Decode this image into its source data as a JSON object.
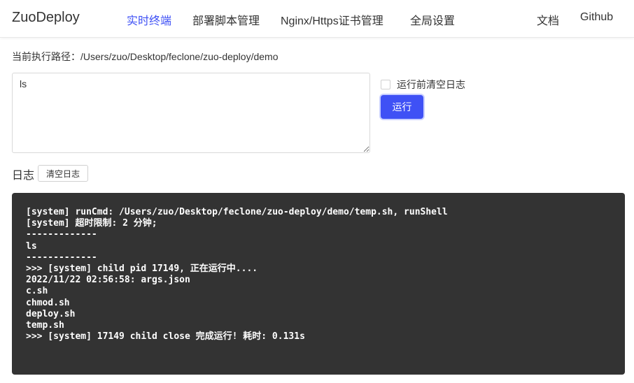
{
  "header": {
    "brand": "ZuoDeploy",
    "nav": [
      {
        "label": "实时终端",
        "active": true
      },
      {
        "label": "部署脚本管理",
        "active": false
      },
      {
        "label": "Nginx/Https证书管理",
        "active": false
      },
      {
        "label": "全局设置",
        "active": false
      }
    ],
    "links": [
      {
        "label": "文档"
      },
      {
        "label": "Github"
      }
    ]
  },
  "main": {
    "path_label": "当前执行路径：/Users/zuo/Desktop/feclone/zuo-deploy/demo",
    "command_value": "ls",
    "clear_before_run_label": "运行前清空日志",
    "clear_before_run_checked": false,
    "run_label": "运行"
  },
  "log": {
    "title": "日志",
    "clear_label": "清空日志",
    "lines": [
      "[system] runCmd: /Users/zuo/Desktop/feclone/zuo-deploy/demo/temp.sh, runShell",
      "[system] 超时限制: 2 分钟;",
      "-------------",
      "ls",
      "-------------",
      ">>> [system] child pid 17149, 正在运行中....",
      "2022/11/22 02:56:58: args.json",
      "c.sh",
      "chmod.sh",
      "deploy.sh",
      "temp.sh",
      ">>> [system] 17149 child close 完成运行! 耗时: 0.131s"
    ]
  },
  "colors": {
    "accent": "#3f51f5",
    "console_bg": "#333333",
    "console_text": "#ffffff"
  }
}
